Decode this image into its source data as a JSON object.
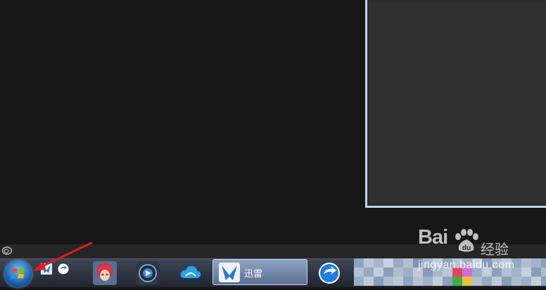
{
  "desktop": {
    "background": "#171717"
  },
  "taskbar": {
    "start_button": {
      "icon": "windows-logo-icon"
    },
    "quick_launch": [
      {
        "icon": "xunlei-bird-icon"
      },
      {
        "icon": "blue-arrow-browser-icon"
      }
    ],
    "pinned": [
      {
        "icon": "anime-game-icon"
      },
      {
        "icon": "video-player-icon"
      },
      {
        "icon": "cloud-icon"
      }
    ],
    "active_task": {
      "icon": "xunlei-bird-icon",
      "label": "迅雷"
    },
    "after_task": [
      {
        "icon": "blue-arrow-browser-icon"
      }
    ]
  },
  "watermark": {
    "brand": "Bai",
    "brand_cn": "经验",
    "url": "jingyan.baidu.com"
  },
  "annotation": {
    "color": "#e41c1c",
    "points_to": "start-button"
  },
  "colors": {
    "window_border": "#b9d3ea",
    "taskbar_top": "#3f4756",
    "taskbar_bottom": "#1f2530",
    "active_task": "#7a8db1"
  }
}
